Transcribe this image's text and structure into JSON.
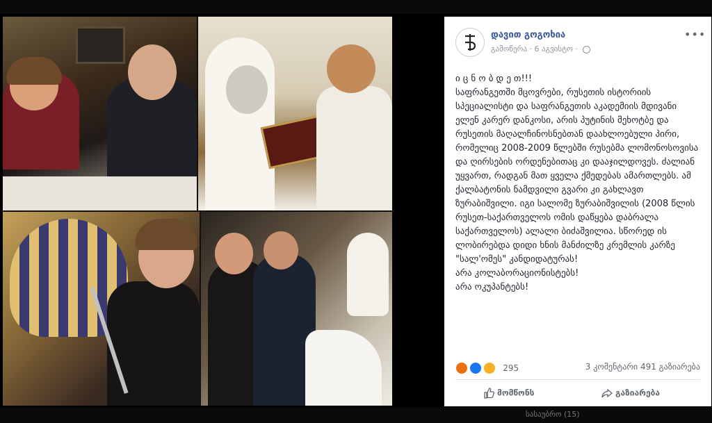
{
  "post": {
    "author": "დავით გოგოხია",
    "meta_prefix": "გამოწერა",
    "date": "6 აგვისტო",
    "more": "•••",
    "body_lines": [
      "ი ც ნ ო ბ დ ე თ!!!",
      "საფრანგეთში მცოვრები, რუსეთის ისტორიის სპეციალისტი და საფრანგეთის აკადემიის მდივანი ელენ კარერ დანკოსი, არის პუტინის მეხოტბე და რუსეთის მაღალჩინოსნებთან დაახლოებული პირი, რომელიც 2008-2009 წლებში რუსებმა ლომონოსოვისა და ღირსების ორდენებითაც კი დააჯილდოვეს. ძალიან უყვართ, რადგან მათ ყველა ქმედებას ამართლებს. ამ ქალბატონის ნამდვილი გვარი კი გახლავთ ზურაბიშვილი. იგი სალომე ზურაბიშვილის (2008 წლის რუსეთ-საქართველოს ომის დაწყება დაბრალა საქართველოს) ალალი ბიძაშვილია. სწორედ ის ლობირებდა დიდი ხნის მანძილზე კრემლის კარზე \"სალ'ომეს\" კანდიდატურას!",
      "არა კოლაბორაციონისტებს!",
      "არა ოკუპანტებს!"
    ],
    "reaction_count": "295",
    "stats": "3 კომენტარი   491 გაზიარება",
    "like_label": "მომწონს",
    "share_label": "გაზიარება"
  },
  "bottom_bar": {
    "label": "სასაუბრო (15)"
  }
}
